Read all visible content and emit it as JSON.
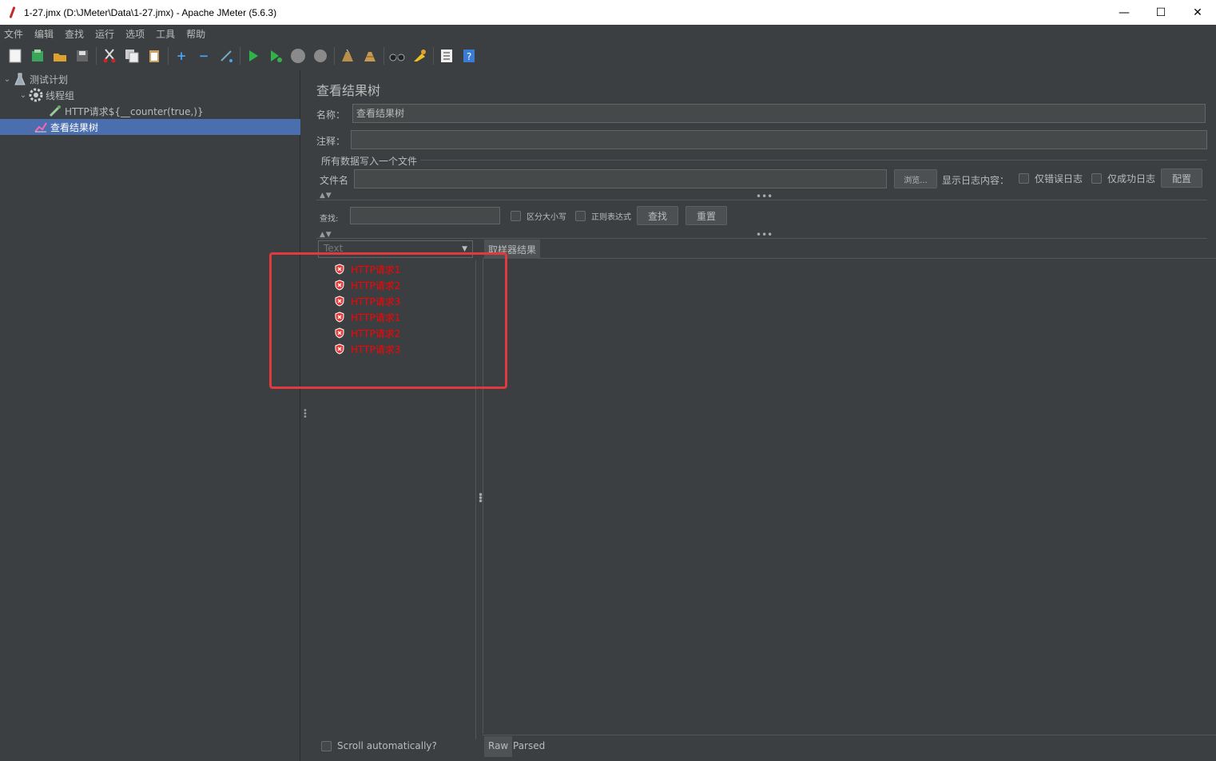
{
  "window": {
    "title": "1-27.jmx (D:\\JMeter\\Data\\1-27.jmx) - Apache JMeter (5.6.3)",
    "minimize": "—",
    "maximize": "☐",
    "close": "✕"
  },
  "menu": [
    "文件",
    "编辑",
    "查找",
    "运行",
    "选项",
    "工具",
    "帮助"
  ],
  "tree": {
    "test_plan": "测试计划",
    "thread_group": "线程组",
    "http_request": "HTTP请求${__counter(true,)}",
    "result_tree": "查看结果树"
  },
  "panel": {
    "title": "查看结果树",
    "name_label": "名称：",
    "name_value": "查看结果树",
    "comment_label": "注释：",
    "comment_value": "",
    "file_section": "所有数据写入一个文件",
    "filename_label": "文件名",
    "filename_value": "",
    "browse_button": "浏览...",
    "log_label": "显示日志内容：",
    "errors_only": "仅错误日志",
    "success_only": "仅成功日志",
    "config_button": "配置",
    "search_label": "查找:",
    "search_value": "",
    "case_sensitive": "区分大小写",
    "regex": "正则表达式",
    "find_button": "查找",
    "reset_button": "重置",
    "renderer": "Text",
    "sampler_tab": "取样器结果",
    "scroll_auto": "Scroll automatically?",
    "raw_tab": "Raw",
    "parsed_tab": "Parsed"
  },
  "results": [
    "HTTP请求1",
    "HTTP请求2",
    "HTTP请求3",
    "HTTP请求1",
    "HTTP请求2",
    "HTTP请求3"
  ],
  "colors": {
    "error_text": "#ff0000",
    "selection": "#4b6eaf",
    "highlight_box": "#e0393e"
  }
}
